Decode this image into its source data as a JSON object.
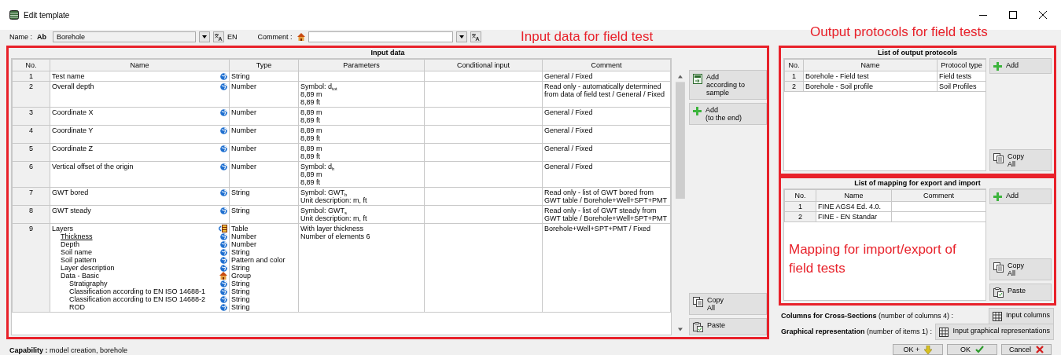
{
  "window": {
    "title": "Edit template"
  },
  "name_field": {
    "label": "Name :",
    "badge": "Ab",
    "value": "Borehole",
    "language": "EN"
  },
  "comment_field": {
    "label": "Comment :"
  },
  "input_data": {
    "title": "Input data",
    "annotation": "Input data for field test",
    "columns": [
      "No.",
      "Name",
      "Type",
      "Parameters",
      "Conditional input",
      "Comment"
    ],
    "rows": [
      {
        "no": "1",
        "name": "Test name",
        "kind": "field",
        "type": "String",
        "parameters": [],
        "comment": "General / Fixed"
      },
      {
        "no": "2",
        "name": "Overall depth",
        "kind": "field",
        "type": "Number",
        "parameters": [
          "Symbol: d$_{tot}$",
          "8,89 m",
          "8,89 ft"
        ],
        "comment": "Read only - automatically determined from data of field test / General / Fixed"
      },
      {
        "no": "3",
        "name": "Coordinate X",
        "kind": "field",
        "type": "Number",
        "parameters": [
          "8,89 m",
          "8,89 ft"
        ],
        "comment": "General / Fixed"
      },
      {
        "no": "4",
        "name": "Coordinate Y",
        "kind": "field",
        "type": "Number",
        "parameters": [
          "8,89 m",
          "8,89 ft"
        ],
        "comment": "General / Fixed"
      },
      {
        "no": "5",
        "name": "Coordinate Z",
        "kind": "field",
        "type": "Number",
        "parameters": [
          "8,89 m",
          "8,89 ft"
        ],
        "comment": "General / Fixed"
      },
      {
        "no": "6",
        "name": "Vertical offset of the origin",
        "kind": "field",
        "type": "Number",
        "parameters": [
          "Symbol: d$_{h}$",
          "8,89 m",
          "8,89 ft"
        ],
        "comment": "General / Fixed"
      },
      {
        "no": "7",
        "name": "GWT bored",
        "kind": "field",
        "type": "String",
        "parameters": [
          "Symbol: GWT$_{b}$",
          "Unit description: m, ft"
        ],
        "comment": "Read only - list of GWT bored from GWT table / Borehole+Well+SPT+PMT"
      },
      {
        "no": "8",
        "name": "GWT steady",
        "kind": "field",
        "type": "String",
        "parameters": [
          "Symbol: GWT$_{s}$",
          "Unit description: m, ft"
        ],
        "comment": "Read only - list of GWT steady from GWT table / Borehole+Well+SPT+PMT"
      },
      {
        "no": "9",
        "name": "Layers",
        "kind": "table",
        "type": "Table",
        "parameters": [
          "With layer thickness",
          "Number of elements 6"
        ],
        "comment": "Borehole+Well+SPT+PMT / Fixed",
        "children": [
          {
            "name": "Thickness",
            "kind": "field",
            "type": "Number",
            "underlined": true
          },
          {
            "name": "Depth",
            "kind": "field",
            "type": "Number",
            "underlined": false
          },
          {
            "name": "Soil name",
            "kind": "field",
            "type": "String",
            "underlined": false
          },
          {
            "name": "Soil pattern",
            "kind": "field",
            "type": "Pattern and color",
            "underlined": false
          },
          {
            "name": "Layer description",
            "kind": "field",
            "type": "String",
            "underlined": false
          },
          {
            "name": "Data - Basic",
            "kind": "group",
            "type": "Group",
            "underlined": false,
            "children": [
              {
                "name": "Stratigraphy",
                "kind": "field",
                "type": "String",
                "underlined": false
              },
              {
                "name": "Classification according to EN ISO 14688-1",
                "kind": "field",
                "type": "String",
                "underlined": false
              },
              {
                "name": "Classification according to EN ISO 14688-2",
                "kind": "field",
                "type": "String",
                "underlined": false
              },
              {
                "name": "ROD",
                "kind": "field",
                "type": "String",
                "underlined": false
              }
            ]
          }
        ]
      }
    ],
    "buttons_top": [
      {
        "kind": "add-sample",
        "lines": [
          "Add",
          "according to sample"
        ]
      },
      {
        "kind": "add",
        "lines": [
          "Add",
          "(to the end)"
        ]
      }
    ],
    "buttons_bottom": [
      {
        "kind": "copy",
        "lines": [
          "Copy",
          "All"
        ]
      },
      {
        "kind": "paste",
        "lines": [
          "Paste"
        ]
      }
    ]
  },
  "output_protocols": {
    "title": "List of output protocols",
    "annotation": "Output protocols for field tests",
    "columns": [
      "No.",
      "Name",
      "Protocol type"
    ],
    "rows": [
      {
        "no": "1",
        "name": "Borehole - Field test",
        "type": "Field tests"
      },
      {
        "no": "2",
        "name": "Borehole - Soil profile",
        "type": "Soil Profiles"
      }
    ],
    "buttons_top": [
      {
        "kind": "add",
        "lines": [
          "Add"
        ]
      }
    ],
    "buttons_bottom": [
      {
        "kind": "copy",
        "lines": [
          "Copy",
          "All"
        ]
      }
    ]
  },
  "mapping": {
    "title": "List of mapping for export and import",
    "annotation": "Mapping for import/export of field tests",
    "columns": [
      "No.",
      "Name",
      "Comment"
    ],
    "rows": [
      {
        "no": "1",
        "name": "FINE AGS4 Ed. 4.0."
      },
      {
        "no": "2",
        "name": "FINE - EN Standar"
      }
    ],
    "buttons_top": [
      {
        "kind": "add",
        "lines": [
          "Add"
        ]
      }
    ],
    "buttons_bottom": [
      {
        "kind": "copy",
        "lines": [
          "Copy",
          "All"
        ]
      },
      {
        "kind": "paste",
        "lines": [
          "Paste"
        ]
      }
    ]
  },
  "settings": [
    {
      "text": "**Columns for Cross-Sections** (number of columns 4) :",
      "button": {
        "kind": "grid",
        "lines": [
          "Input columns"
        ]
      }
    },
    {
      "text": "**Graphical representation**  (number of items 1) :",
      "button": {
        "kind": "grid",
        "lines": [
          "Input graphical representations"
        ]
      }
    }
  ],
  "capability": "**Capability :** model creation, borehole",
  "dialog_buttons": [
    {
      "kind": "ok-plus",
      "label": "OK +"
    },
    {
      "kind": "ok",
      "label": "OK"
    },
    {
      "kind": "cancel",
      "label": "Cancel"
    }
  ]
}
